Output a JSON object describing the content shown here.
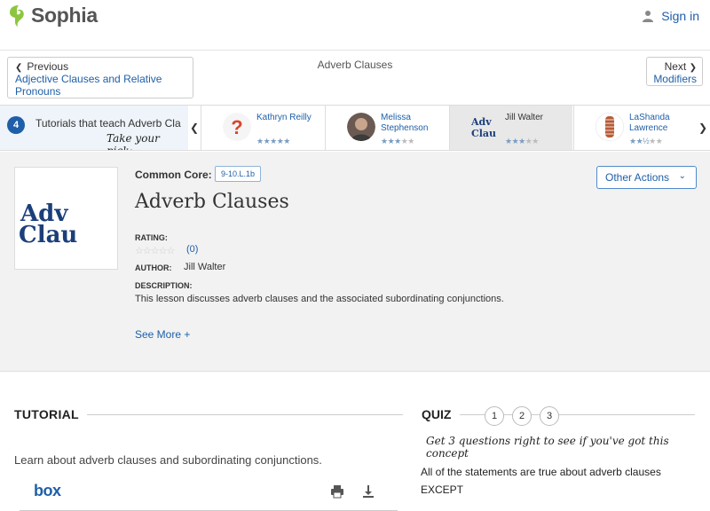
{
  "header": {
    "logo_text": "Sophia",
    "signin_label": "Sign in"
  },
  "nav": {
    "prev_label": "Previous",
    "prev_link": "Adjective Clauses and Relative Pronouns",
    "title": "Adverb Clauses",
    "next_label": "Next",
    "next_link": "Modifiers"
  },
  "tutorials_bar": {
    "count": "4",
    "text": "Tutorials that teach Adverb Cla",
    "pick": "Take your pick:",
    "teachers": [
      {
        "name": "Kathryn Reilly",
        "rating": 5
      },
      {
        "name": "Melissa Stephenson",
        "rating": 3
      },
      {
        "name": "Jill Walter",
        "rating": 3,
        "active": true
      },
      {
        "name": "LaShanda Lawrence",
        "rating": 2.5
      }
    ]
  },
  "lesson": {
    "thumb_line1": "Adv",
    "thumb_line2": "Clau",
    "common_core_label": "Common Core:",
    "common_core_tag": "9-10.L.1b",
    "other_actions": "Other Actions",
    "title": "Adverb Clauses",
    "rating_label": "RATING:",
    "rating_count": "(0)",
    "author_label": "AUTHOR:",
    "author": "Jill Walter",
    "description_label": "DESCRIPTION:",
    "description": "This lesson discusses adverb clauses and the associated subordinating conjunctions.",
    "see_more": "See More +"
  },
  "tutorial": {
    "heading": "TUTORIAL",
    "lead": "Learn about adverb clauses and subordinating conjunctions.",
    "box_logo": "box"
  },
  "quiz": {
    "heading": "QUIZ",
    "numbers": [
      "1",
      "2",
      "3"
    ],
    "hint": "Get 3 questions right to see if you've got this concept",
    "question": "All of the statements are true about adverb clauses EXCEPT"
  },
  "colors": {
    "accent": "#1f5fa8",
    "logo_green": "#8cc63f"
  }
}
